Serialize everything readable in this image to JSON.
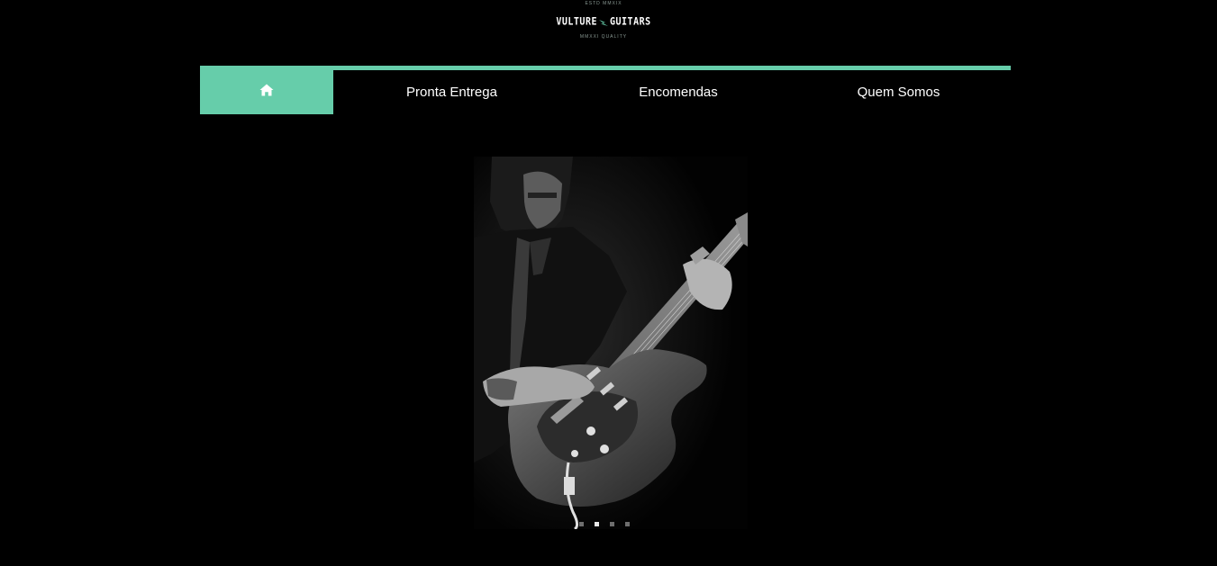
{
  "logo": {
    "estd": "ESTD MMXIX",
    "brand_left": "VULTURE",
    "brand_right": "GUITARS",
    "tagline": "MMXXI QUALITY",
    "accent": "#66cdaa"
  },
  "nav": {
    "accent": "#66cdaa",
    "home_icon": "home-icon",
    "items": [
      {
        "label": "Pronta Entrega"
      },
      {
        "label": "Encomendas"
      },
      {
        "label": "Quem Somos"
      }
    ]
  },
  "slider": {
    "image_alt": "Guitarist playing an electric guitar in black and white",
    "slide_count": 4,
    "active_index": 1
  }
}
